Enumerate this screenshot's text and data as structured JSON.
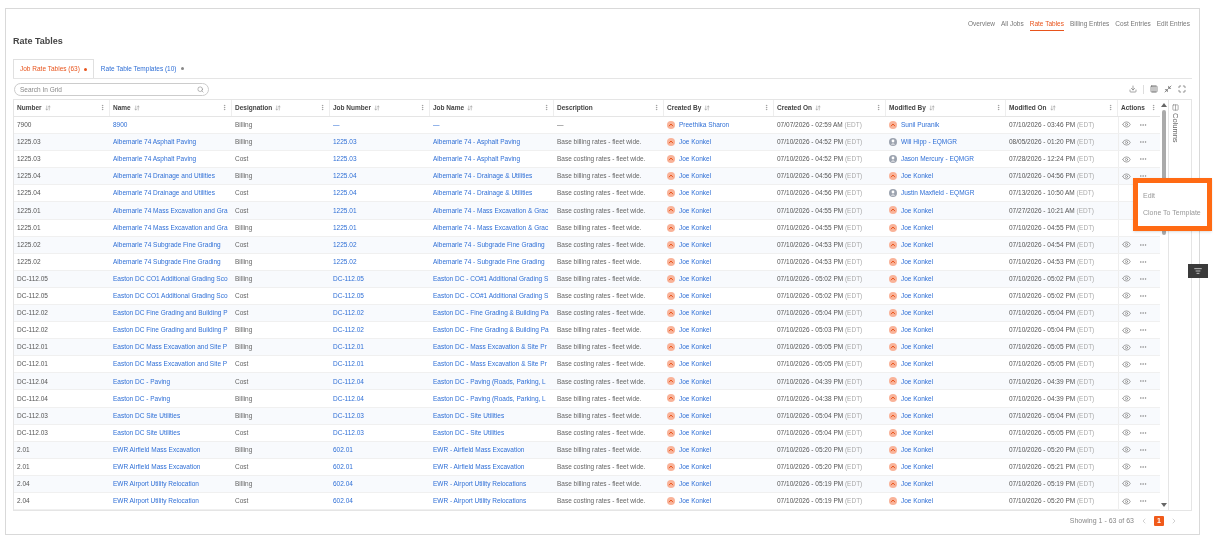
{
  "nav": [
    {
      "label": "Overview",
      "selected": false
    },
    {
      "label": "All Jobs",
      "selected": false
    },
    {
      "label": "Rate Tables",
      "selected": true
    },
    {
      "label": "Billing Entries",
      "selected": false
    },
    {
      "label": "Cost Entries",
      "selected": false
    },
    {
      "label": "Edit Entries",
      "selected": false
    }
  ],
  "title": "Rate Tables",
  "tabs": [
    {
      "label": "Job Rate Tables (63)",
      "selected": true
    },
    {
      "label": "Rate Table Templates (10)",
      "selected": false
    }
  ],
  "search": {
    "placeholder": "Search In Grid"
  },
  "columns": [
    {
      "label": "Number",
      "sortable": true
    },
    {
      "label": "Name",
      "sortable": true
    },
    {
      "label": "Designation",
      "sortable": true
    },
    {
      "label": "Job Number",
      "sortable": true
    },
    {
      "label": "Job Name",
      "sortable": true
    },
    {
      "label": "Description",
      "sortable": false
    },
    {
      "label": "Created By",
      "sortable": true
    },
    {
      "label": "Created On",
      "sortable": true
    },
    {
      "label": "Modified By",
      "sortable": true
    },
    {
      "label": "Modified On",
      "sortable": true
    },
    {
      "label": "Actions",
      "sortable": false
    }
  ],
  "rows": [
    {
      "menu_open": false,
      "number": "7900",
      "name": "8900",
      "designation": "Billing",
      "job_number": "—",
      "job_name": "—",
      "description": "—",
      "created_by": {
        "name": "Preethika Sharon",
        "kind": "initials"
      },
      "created_on": {
        "date": "07/07/2026 - 02:59 AM",
        "tz": "(EDT)"
      },
      "modified_by": {
        "name": "Sunil Puranik",
        "kind": "initials"
      },
      "modified_on": {
        "date": "07/10/2026 - 03:46 PM",
        "tz": "(EDT)"
      }
    },
    {
      "menu_open": false,
      "number": "1225.03",
      "name": "Albemarle 74 Asphalt Paving",
      "designation": "Billing",
      "job_number": "1225.03",
      "job_name": "Albemarle 74 - Asphalt Paving",
      "description": "Base billing rates - fleet wide.",
      "created_by": {
        "name": "Joe Konkel",
        "kind": "initials"
      },
      "created_on": {
        "date": "07/10/2026 - 04:52 PM",
        "tz": "(EDT)"
      },
      "modified_by": {
        "name": "Will Hipp - EQMGR",
        "kind": "generic"
      },
      "modified_on": {
        "date": "08/05/2026 - 01:20 PM",
        "tz": "(EDT)"
      }
    },
    {
      "menu_open": false,
      "number": "1225.03",
      "name": "Albemarle 74 Asphalt Paving",
      "designation": "Cost",
      "job_number": "1225.03",
      "job_name": "Albemarle 74 - Asphalt Paving",
      "description": "Base costing rates - fleet wide.",
      "created_by": {
        "name": "Joe Konkel",
        "kind": "initials"
      },
      "created_on": {
        "date": "07/10/2026 - 04:52 PM",
        "tz": "(EDT)"
      },
      "modified_by": {
        "name": "Jason Mercury - EQMGR",
        "kind": "generic"
      },
      "modified_on": {
        "date": "07/28/2026 - 12:24 PM",
        "tz": "(EDT)"
      }
    },
    {
      "menu_open": true,
      "number": "1225.04",
      "name": "Albemarle 74 Drainage and Utilities",
      "designation": "Billing",
      "job_number": "1225.04",
      "job_name": "Albemarle 74 - Drainage & Utilities",
      "description": "Base billing rates - fleet wide.",
      "created_by": {
        "name": "Joe Konkel",
        "kind": "initials"
      },
      "created_on": {
        "date": "07/10/2026 - 04:56 PM",
        "tz": "(EDT)"
      },
      "modified_by": {
        "name": "Joe Konkel",
        "kind": "initials"
      },
      "modified_on": {
        "date": "07/10/2026 - 04:56 PM",
        "tz": "(EDT)"
      }
    },
    {
      "menu_open": false,
      "number": "1225.04",
      "name": "Albemarle 74 Drainage and Utilities",
      "designation": "Cost",
      "job_number": "1225.04",
      "job_name": "Albemarle 74 - Drainage & Utilities",
      "description": "Base costing rates - fleet wide.",
      "created_by": {
        "name": "Joe Konkel",
        "kind": "initials"
      },
      "created_on": {
        "date": "07/10/2026 - 04:56 PM",
        "tz": "(EDT)"
      },
      "modified_by": {
        "name": "Justin Maxfield - EQMGR",
        "kind": "generic"
      },
      "modified_on": {
        "date": "07/13/2026 - 10:50 AM",
        "tz": "(EDT)"
      }
    },
    {
      "menu_open": false,
      "number": "1225.01",
      "name": "Albemarle 74 Mass Excavation and Gra",
      "designation": "Cost",
      "job_number": "1225.01",
      "job_name": "Albemarle 74 - Mass Excavation & Grac",
      "description": "Base costing rates - fleet wide.",
      "created_by": {
        "name": "Joe Konkel",
        "kind": "initials"
      },
      "created_on": {
        "date": "07/10/2026 - 04:55 PM",
        "tz": "(EDT)"
      },
      "modified_by": {
        "name": "Joe Konkel",
        "kind": "initials"
      },
      "modified_on": {
        "date": "07/27/2026 - 10:21 AM",
        "tz": "(EDT)"
      }
    },
    {
      "menu_open": false,
      "number": "1225.01",
      "name": "Albemarle 74 Mass Excavation and Gra",
      "designation": "Billing",
      "job_number": "1225.01",
      "job_name": "Albemarle 74 - Mass Excavation & Grac",
      "description": "Base billing rates - fleet wide.",
      "created_by": {
        "name": "Joe Konkel",
        "kind": "initials"
      },
      "created_on": {
        "date": "07/10/2026 - 04:55 PM",
        "tz": "(EDT)"
      },
      "modified_by": {
        "name": "Joe Konkel",
        "kind": "initials"
      },
      "modified_on": {
        "date": "07/10/2026 - 04:55 PM",
        "tz": "(EDT)"
      }
    },
    {
      "menu_open": false,
      "number": "1225.02",
      "name": "Albemarle 74 Subgrade Fine Grading",
      "designation": "Cost",
      "job_number": "1225.02",
      "job_name": "Albemarle 74 - Subgrade Fine Grading",
      "description": "Base costing rates - fleet wide.",
      "created_by": {
        "name": "Joe Konkel",
        "kind": "initials"
      },
      "created_on": {
        "date": "07/10/2026 - 04:53 PM",
        "tz": "(EDT)"
      },
      "modified_by": {
        "name": "Joe Konkel",
        "kind": "initials"
      },
      "modified_on": {
        "date": "07/10/2026 - 04:54 PM",
        "tz": "(EDT)"
      }
    },
    {
      "menu_open": false,
      "number": "1225.02",
      "name": "Albemarle 74 Subgrade Fine Grading",
      "designation": "Billing",
      "job_number": "1225.02",
      "job_name": "Albemarle 74 - Subgrade Fine Grading",
      "description": "Base billing rates - fleet wide.",
      "created_by": {
        "name": "Joe Konkel",
        "kind": "initials"
      },
      "created_on": {
        "date": "07/10/2026 - 04:53 PM",
        "tz": "(EDT)"
      },
      "modified_by": {
        "name": "Joe Konkel",
        "kind": "initials"
      },
      "modified_on": {
        "date": "07/10/2026 - 04:53 PM",
        "tz": "(EDT)"
      }
    },
    {
      "menu_open": false,
      "number": "DC-112.05",
      "name": "Easton DC CO1 Additional Grading Sco",
      "designation": "Billing",
      "job_number": "DC-112.05",
      "job_name": "Easton DC - CO#1 Additional Grading S",
      "description": "Base billing rates - fleet wide.",
      "created_by": {
        "name": "Joe Konkel",
        "kind": "initials"
      },
      "created_on": {
        "date": "07/10/2026 - 05:02 PM",
        "tz": "(EDT)"
      },
      "modified_by": {
        "name": "Joe Konkel",
        "kind": "initials"
      },
      "modified_on": {
        "date": "07/10/2026 - 05:02 PM",
        "tz": "(EDT)"
      }
    },
    {
      "menu_open": false,
      "number": "DC-112.05",
      "name": "Easton DC CO1 Additional Grading Sco",
      "designation": "Cost",
      "job_number": "DC-112.05",
      "job_name": "Easton DC - CO#1 Additional Grading S",
      "description": "Base costing rates - fleet wide.",
      "created_by": {
        "name": "Joe Konkel",
        "kind": "initials"
      },
      "created_on": {
        "date": "07/10/2026 - 05:02 PM",
        "tz": "(EDT)"
      },
      "modified_by": {
        "name": "Joe Konkel",
        "kind": "initials"
      },
      "modified_on": {
        "date": "07/10/2026 - 05:02 PM",
        "tz": "(EDT)"
      }
    },
    {
      "menu_open": false,
      "number": "DC-112.02",
      "name": "Easton DC Fine Grading and Building P",
      "designation": "Cost",
      "job_number": "DC-112.02",
      "job_name": "Easton DC - Fine Grading & Building Pa",
      "description": "Base costing rates - fleet wide.",
      "created_by": {
        "name": "Joe Konkel",
        "kind": "initials"
      },
      "created_on": {
        "date": "07/10/2026 - 05:04 PM",
        "tz": "(EDT)"
      },
      "modified_by": {
        "name": "Joe Konkel",
        "kind": "initials"
      },
      "modified_on": {
        "date": "07/10/2026 - 05:04 PM",
        "tz": "(EDT)"
      }
    },
    {
      "menu_open": false,
      "number": "DC-112.02",
      "name": "Easton DC Fine Grading and Building P",
      "designation": "Billing",
      "job_number": "DC-112.02",
      "job_name": "Easton DC - Fine Grading & Building Pa",
      "description": "Base billing rates - fleet wide.",
      "created_by": {
        "name": "Joe Konkel",
        "kind": "initials"
      },
      "created_on": {
        "date": "07/10/2026 - 05:03 PM",
        "tz": "(EDT)"
      },
      "modified_by": {
        "name": "Joe Konkel",
        "kind": "initials"
      },
      "modified_on": {
        "date": "07/10/2026 - 05:04 PM",
        "tz": "(EDT)"
      }
    },
    {
      "menu_open": false,
      "number": "DC-112.01",
      "name": "Easton DC Mass Excavation and Site P",
      "designation": "Billing",
      "job_number": "DC-112.01",
      "job_name": "Easton DC - Mass Excavation & Site Pr",
      "description": "Base billing rates - fleet wide.",
      "created_by": {
        "name": "Joe Konkel",
        "kind": "initials"
      },
      "created_on": {
        "date": "07/10/2026 - 05:05 PM",
        "tz": "(EDT)"
      },
      "modified_by": {
        "name": "Joe Konkel",
        "kind": "initials"
      },
      "modified_on": {
        "date": "07/10/2026 - 05:05 PM",
        "tz": "(EDT)"
      }
    },
    {
      "menu_open": false,
      "number": "DC-112.01",
      "name": "Easton DC Mass Excavation and Site P",
      "designation": "Cost",
      "job_number": "DC-112.01",
      "job_name": "Easton DC - Mass Excavation & Site Pr",
      "description": "Base costing rates - fleet wide.",
      "created_by": {
        "name": "Joe Konkel",
        "kind": "initials"
      },
      "created_on": {
        "date": "07/10/2026 - 05:05 PM",
        "tz": "(EDT)"
      },
      "modified_by": {
        "name": "Joe Konkel",
        "kind": "initials"
      },
      "modified_on": {
        "date": "07/10/2026 - 05:05 PM",
        "tz": "(EDT)"
      }
    },
    {
      "menu_open": false,
      "number": "DC-112.04",
      "name": "Easton DC - Paving",
      "designation": "Cost",
      "job_number": "DC-112.04",
      "job_name": "Easton DC - Paving (Roads, Parking, L",
      "description": "Base costing rates - fleet wide.",
      "created_by": {
        "name": "Joe Konkel",
        "kind": "initials"
      },
      "created_on": {
        "date": "07/10/2026 - 04:39 PM",
        "tz": "(EDT)"
      },
      "modified_by": {
        "name": "Joe Konkel",
        "kind": "initials"
      },
      "modified_on": {
        "date": "07/10/2026 - 04:39 PM",
        "tz": "(EDT)"
      }
    },
    {
      "menu_open": false,
      "number": "DC-112.04",
      "name": "Easton DC - Paving",
      "designation": "Billing",
      "job_number": "DC-112.04",
      "job_name": "Easton DC - Paving (Roads, Parking, L",
      "description": "Base billing rates - fleet wide.",
      "created_by": {
        "name": "Joe Konkel",
        "kind": "initials"
      },
      "created_on": {
        "date": "07/10/2026 - 04:38 PM",
        "tz": "(EDT)"
      },
      "modified_by": {
        "name": "Joe Konkel",
        "kind": "initials"
      },
      "modified_on": {
        "date": "07/10/2026 - 04:39 PM",
        "tz": "(EDT)"
      }
    },
    {
      "menu_open": false,
      "number": "DC-112.03",
      "name": "Easton DC Site Utilities",
      "designation": "Billing",
      "job_number": "DC-112.03",
      "job_name": "Easton DC - Site Utilities",
      "description": "Base billing rates - fleet wide.",
      "created_by": {
        "name": "Joe Konkel",
        "kind": "initials"
      },
      "created_on": {
        "date": "07/10/2026 - 05:04 PM",
        "tz": "(EDT)"
      },
      "modified_by": {
        "name": "Joe Konkel",
        "kind": "initials"
      },
      "modified_on": {
        "date": "07/10/2026 - 05:04 PM",
        "tz": "(EDT)"
      }
    },
    {
      "menu_open": false,
      "number": "DC-112.03",
      "name": "Easton DC Site Utilities",
      "designation": "Cost",
      "job_number": "DC-112.03",
      "job_name": "Easton DC - Site Utilities",
      "description": "Base costing rates - fleet wide.",
      "created_by": {
        "name": "Joe Konkel",
        "kind": "initials"
      },
      "created_on": {
        "date": "07/10/2026 - 05:04 PM",
        "tz": "(EDT)"
      },
      "modified_by": {
        "name": "Joe Konkel",
        "kind": "initials"
      },
      "modified_on": {
        "date": "07/10/2026 - 05:05 PM",
        "tz": "(EDT)"
      }
    },
    {
      "menu_open": false,
      "number": "2.01",
      "name": "EWR Airfield Mass Excavation",
      "designation": "Billing",
      "job_number": "602.01",
      "job_name": "EWR - Airfield Mass Excavation",
      "description": "Base billing rates - fleet wide.",
      "created_by": {
        "name": "Joe Konkel",
        "kind": "initials"
      },
      "created_on": {
        "date": "07/10/2026 - 05:20 PM",
        "tz": "(EDT)"
      },
      "modified_by": {
        "name": "Joe Konkel",
        "kind": "initials"
      },
      "modified_on": {
        "date": "07/10/2026 - 05:20 PM",
        "tz": "(EDT)"
      }
    },
    {
      "menu_open": false,
      "number": "2.01",
      "name": "EWR Airfield Mass Excavation",
      "designation": "Cost",
      "job_number": "602.01",
      "job_name": "EWR - Airfield Mass Excavation",
      "description": "Base costing rates - fleet wide.",
      "created_by": {
        "name": "Joe Konkel",
        "kind": "initials"
      },
      "created_on": {
        "date": "07/10/2026 - 05:20 PM",
        "tz": "(EDT)"
      },
      "modified_by": {
        "name": "Joe Konkel",
        "kind": "initials"
      },
      "modified_on": {
        "date": "07/10/2026 - 05:21 PM",
        "tz": "(EDT)"
      }
    },
    {
      "menu_open": false,
      "number": "2.04",
      "name": "EWR Airport Utility Relocation",
      "designation": "Billing",
      "job_number": "602.04",
      "job_name": "EWR - Airport Utility Relocations",
      "description": "Base billing rates - fleet wide.",
      "created_by": {
        "name": "Joe Konkel",
        "kind": "initials"
      },
      "created_on": {
        "date": "07/10/2026 - 05:19 PM",
        "tz": "(EDT)"
      },
      "modified_by": {
        "name": "Joe Konkel",
        "kind": "initials"
      },
      "modified_on": {
        "date": "07/10/2026 - 05:19 PM",
        "tz": "(EDT)"
      }
    },
    {
      "menu_open": false,
      "number": "2.04",
      "name": "EWR Airport Utility Relocation",
      "designation": "Cost",
      "job_number": "602.04",
      "job_name": "EWR - Airport Utility Relocations",
      "description": "Base costing rates - fleet wide.",
      "created_by": {
        "name": "Joe Konkel",
        "kind": "initials"
      },
      "created_on": {
        "date": "07/10/2026 - 05:19 PM",
        "tz": "(EDT)"
      },
      "modified_by": {
        "name": "Joe Konkel",
        "kind": "initials"
      },
      "modified_on": {
        "date": "07/10/2026 - 05:20 PM",
        "tz": "(EDT)"
      }
    }
  ],
  "side_panel": {
    "label": "Columns"
  },
  "menu": {
    "items": [
      "Edit",
      "Clone To Template"
    ]
  },
  "footer": {
    "summary": "Showing 1 - 63 of 63",
    "pages": [
      {
        "label": "1",
        "selected": true
      }
    ]
  }
}
